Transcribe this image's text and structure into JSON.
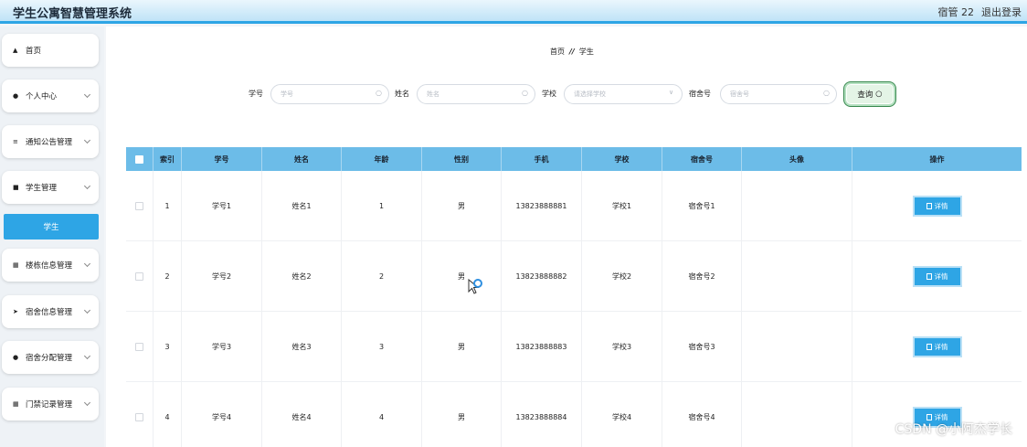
{
  "header": {
    "title": "学生公寓智慧管理系统",
    "user": "宿管 22",
    "logout": "退出登录"
  },
  "sidebar": {
    "items": [
      {
        "label": "首页",
        "icon": "home-icon"
      },
      {
        "label": "个人中心",
        "icon": "user-icon"
      },
      {
        "label": "通知公告管理",
        "icon": "sliders-icon"
      },
      {
        "label": "学生管理",
        "icon": "thumb-icon"
      },
      {
        "label": "楼栋信息管理",
        "icon": "grid-icon"
      },
      {
        "label": "宿舍信息管理",
        "icon": "send-icon"
      },
      {
        "label": "宿舍分配管理",
        "icon": "user-icon"
      },
      {
        "label": "门禁记录管理",
        "icon": "grid-icon"
      }
    ],
    "active_sub": "学生"
  },
  "breadcrumb": {
    "home": "首页",
    "sep": "//",
    "current": "学生"
  },
  "search": {
    "student_id_label": "学号",
    "student_id_placeholder": "学号",
    "name_label": "姓名",
    "name_placeholder": "姓名",
    "school_label": "学校",
    "school_placeholder": "请选择学校",
    "dorm_label": "宿舍号",
    "dorm_placeholder": "宿舍号",
    "button": "查询"
  },
  "table": {
    "columns": [
      "",
      "索引",
      "学号",
      "姓名",
      "年龄",
      "性别",
      "手机",
      "学校",
      "宿舍号",
      "头像",
      "操作"
    ],
    "detail_label": "详情",
    "rows": [
      {
        "index": "1",
        "student_id": "学号1",
        "name": "姓名1",
        "age": "1",
        "gender": "男",
        "phone": "13823888881",
        "school": "学校1",
        "dorm": "宿舍号1"
      },
      {
        "index": "2",
        "student_id": "学号2",
        "name": "姓名2",
        "age": "2",
        "gender": "男",
        "phone": "13823888882",
        "school": "学校2",
        "dorm": "宿舍号2"
      },
      {
        "index": "3",
        "student_id": "学号3",
        "name": "姓名3",
        "age": "3",
        "gender": "男",
        "phone": "13823888883",
        "school": "学校3",
        "dorm": "宿舍号3"
      },
      {
        "index": "4",
        "student_id": "学号4",
        "name": "姓名4",
        "age": "4",
        "gender": "男",
        "phone": "13823888884",
        "school": "学校4",
        "dorm": "宿舍号4"
      }
    ]
  },
  "watermark": "CSDN @小阿杰学长"
}
